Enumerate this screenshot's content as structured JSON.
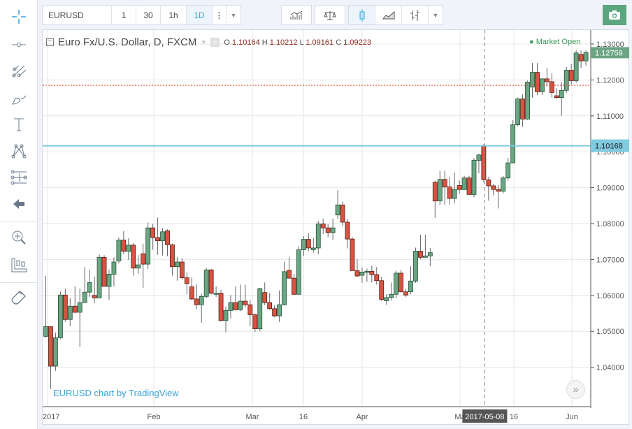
{
  "toolbar": {
    "symbol": "EURUSD",
    "intervals": [
      "1",
      "30",
      "1h",
      "1D"
    ],
    "active_interval": "1D",
    "more_icon": "vertical-dots-icon",
    "dropdown_icon": "chevron-down-icon",
    "indicators_icon": "indicators-icon",
    "compare_icon": "scales-icon",
    "chart_styles": [
      "candles-icon",
      "area-icon",
      "bars-icon"
    ],
    "active_style": "candles-icon",
    "camera_icon": "camera-icon"
  },
  "left_tools": [
    "crosshair-icon",
    "horizontal-line-icon",
    "pitchfork-icon",
    "brush-icon",
    "text-icon",
    "pattern-icon",
    "fib-icon",
    "back-arrow-icon",
    "zoom-in-icon",
    "measure-icon",
    "magnet-icon"
  ],
  "legend": {
    "title": "Euro Fx/U.S. Dollar, D, FXCM",
    "o_label": "O",
    "o": "1.10164",
    "h_label": "H",
    "h": "1.10212",
    "l_label": "L",
    "l": "1.09161",
    "c_label": "C",
    "c": "1.09223"
  },
  "market_status": "Market Open",
  "watermark": "EURUSD chart by TradingView",
  "colors": {
    "up": "#6ba583",
    "down": "#d75442",
    "up_border": "#225437",
    "down_border": "#5b1a13",
    "last_price": "#6ba583",
    "crosshair_line": "#7fcbe0",
    "alert_line": "#e5432f",
    "status": "#3a9a5b"
  },
  "chart_data": {
    "type": "candlestick",
    "title": "Euro Fx/U.S. Dollar, D, FXCM",
    "ylim": [
      1.03,
      1.135
    ],
    "y_ticks": [
      "1.13000",
      "1.12000",
      "1.11000",
      "1.10000",
      "1.09000",
      "1.08000",
      "1.07000",
      "1.06000",
      "1.05000",
      "1.04000"
    ],
    "x_ticks": [
      "2017",
      "Feb",
      "Mar",
      "16",
      "Apr",
      "Ma",
      "16",
      "Jun"
    ],
    "crosshair": {
      "date": "2017-05-08",
      "price": "1.10168"
    },
    "last_price": "1.12759",
    "horizontal_line_price": 1.1185,
    "grid": true,
    "ohlc": [
      [
        1.0486,
        1.0654,
        1.0483,
        1.0513
      ],
      [
        1.0513,
        1.0513,
        1.034,
        1.0403
      ],
      [
        1.0403,
        1.0496,
        1.039,
        1.0482
      ],
      [
        1.0482,
        1.0611,
        1.0478,
        1.0601
      ],
      [
        1.0601,
        1.0619,
        1.0526,
        1.0533
      ],
      [
        1.0533,
        1.0593,
        1.0514,
        1.057
      ],
      [
        1.057,
        1.0625,
        1.055,
        1.0553
      ],
      [
        1.0553,
        1.0619,
        1.0456,
        1.058
      ],
      [
        1.058,
        1.0679,
        1.0586,
        1.0609
      ],
      [
        1.0609,
        1.0672,
        1.0596,
        1.0636
      ],
      [
        1.06,
        1.0652,
        1.0579,
        1.0593
      ],
      [
        1.0593,
        1.0714,
        1.0593,
        1.0706
      ],
      [
        1.0706,
        1.0712,
        1.0625,
        1.0625
      ],
      [
        1.0625,
        1.0672,
        1.0587,
        1.0659
      ],
      [
        1.0659,
        1.0706,
        1.0625,
        1.0693
      ],
      [
        1.0696,
        1.0761,
        1.0689,
        1.0754
      ],
      [
        1.0754,
        1.0779,
        1.0715,
        1.0723
      ],
      [
        1.0723,
        1.0759,
        1.0699,
        1.074
      ],
      [
        1.074,
        1.0746,
        1.0655,
        1.0676
      ],
      [
        1.0676,
        1.0712,
        1.066,
        1.0685
      ],
      [
        1.0716,
        1.0744,
        1.0621,
        1.0687
      ],
      [
        1.0687,
        1.0803,
        1.0674,
        1.0788
      ],
      [
        1.0788,
        1.0799,
        1.0727,
        1.0761
      ],
      [
        1.0761,
        1.0817,
        1.0713,
        1.0752
      ],
      [
        1.0752,
        1.0787,
        1.0711,
        1.0777
      ],
      [
        1.078,
        1.0784,
        1.0709,
        1.0741
      ],
      [
        1.0741,
        1.0744,
        1.0655,
        1.068
      ],
      [
        1.068,
        1.0707,
        1.0641,
        1.0693
      ],
      [
        1.0693,
        1.0704,
        1.0644,
        1.0649
      ],
      [
        1.0649,
        1.0664,
        1.0603,
        1.0633
      ],
      [
        1.0624,
        1.065,
        1.0588,
        1.059
      ],
      [
        1.059,
        1.0631,
        1.0562,
        1.0574
      ],
      [
        1.0574,
        1.0605,
        1.0524,
        1.0597
      ],
      [
        1.0597,
        1.0677,
        1.0592,
        1.0671
      ],
      [
        1.0671,
        1.0674,
        1.0603,
        1.0606
      ],
      [
        1.0603,
        1.0625,
        1.0596,
        1.0606
      ],
      [
        1.0606,
        1.0615,
        1.0528,
        1.053
      ],
      [
        1.053,
        1.0569,
        1.0497,
        1.0558
      ],
      [
        1.0558,
        1.0601,
        1.0536,
        1.058
      ],
      [
        1.058,
        1.0625,
        1.0558,
        1.056
      ],
      [
        1.056,
        1.063,
        1.0556,
        1.0584
      ],
      [
        1.0584,
        1.063,
        1.0567,
        1.0574
      ],
      [
        1.0574,
        1.0587,
        1.0514,
        1.0546
      ],
      [
        1.0546,
        1.055,
        1.0498,
        1.0507
      ],
      [
        1.0507,
        1.0621,
        1.05,
        1.0619
      ],
      [
        1.0608,
        1.0636,
        1.0573,
        1.058
      ],
      [
        1.058,
        1.0607,
        1.056,
        1.0563
      ],
      [
        1.0563,
        1.0572,
        1.0539,
        1.0543
      ],
      [
        1.0543,
        1.0614,
        1.0526,
        1.0574
      ],
      [
        1.0574,
        1.0694,
        1.0572,
        1.0666
      ],
      [
        1.067,
        1.0707,
        1.0646,
        1.0648
      ],
      [
        1.0648,
        1.066,
        1.0601,
        1.0603
      ],
      [
        1.0603,
        1.0737,
        1.0603,
        1.0727
      ],
      [
        1.0727,
        1.0765,
        1.071,
        1.0756
      ],
      [
        1.0756,
        1.0773,
        1.0724,
        1.0732
      ],
      [
        1.0727,
        1.0759,
        1.0719,
        1.0732
      ],
      [
        1.0732,
        1.0808,
        1.0715,
        1.0799
      ],
      [
        1.0799,
        1.0814,
        1.0771,
        1.0788
      ],
      [
        1.0788,
        1.0799,
        1.0762,
        1.0775
      ],
      [
        1.0775,
        1.0814,
        1.0754,
        1.0788
      ],
      [
        1.0824,
        1.0893,
        1.0813,
        1.0852
      ],
      [
        1.0852,
        1.0862,
        1.0793,
        1.0804
      ],
      [
        1.0804,
        1.0813,
        1.0731,
        1.0757
      ],
      [
        1.0757,
        1.0762,
        1.0669,
        1.0669
      ],
      [
        1.0669,
        1.0701,
        1.0651,
        1.0654
      ],
      [
        1.0656,
        1.0678,
        1.0635,
        1.0665
      ],
      [
        1.0665,
        1.0674,
        1.0638,
        1.0667
      ],
      [
        1.0667,
        1.0683,
        1.0636,
        1.0658
      ],
      [
        1.0658,
        1.0679,
        1.063,
        1.0641
      ],
      [
        1.0641,
        1.0651,
        1.0584,
        1.0589
      ],
      [
        1.0585,
        1.0603,
        1.0574,
        1.0594
      ],
      [
        1.0594,
        1.0636,
        1.0586,
        1.0603
      ],
      [
        1.0603,
        1.0669,
        1.0592,
        1.0662
      ],
      [
        1.0662,
        1.0671,
        1.0608,
        1.061
      ],
      [
        1.061,
        1.0619,
        1.0596,
        1.0601
      ],
      [
        1.061,
        1.0681,
        1.0603,
        1.064
      ],
      [
        1.064,
        1.0733,
        1.0635,
        1.0723
      ],
      [
        1.0723,
        1.0769,
        1.0701,
        1.0706
      ],
      [
        1.0706,
        1.0769,
        1.0706,
        1.071
      ],
      [
        1.071,
        1.0732,
        1.0681,
        1.0719
      ],
      [
        1.0915,
        1.0919,
        1.0816,
        1.0863
      ],
      [
        1.0863,
        1.0947,
        1.0852,
        1.0923
      ],
      [
        1.0923,
        1.0947,
        1.0852,
        1.0902
      ],
      [
        1.0902,
        1.0929,
        1.0852,
        1.087
      ],
      [
        1.087,
        1.0942,
        1.0856,
        1.0895
      ],
      [
        1.0906,
        1.092,
        1.0883,
        1.0895
      ],
      [
        1.0895,
        1.0933,
        1.0893,
        1.0927
      ],
      [
        1.0927,
        1.0933,
        1.0881,
        1.0881
      ],
      [
        1.0881,
        1.0983,
        1.0873,
        1.0976
      ],
      [
        1.0976,
        1.0995,
        1.094,
        1.0991
      ],
      [
        1.10164,
        1.10212,
        1.09161,
        1.09223
      ],
      [
        1.0922,
        1.093,
        1.0864,
        1.0905
      ],
      [
        1.0905,
        1.0911,
        1.0879,
        1.0895
      ],
      [
        1.0895,
        1.0907,
        1.0842,
        1.089
      ],
      [
        1.089,
        1.0933,
        1.0884,
        1.0927
      ],
      [
        1.0927,
        1.0983,
        1.092,
        1.0969
      ],
      [
        1.0969,
        1.1088,
        1.0969,
        1.1075
      ],
      [
        1.1075,
        1.1151,
        1.1071,
        1.1147
      ],
      [
        1.1147,
        1.116,
        1.1069,
        1.1091
      ],
      [
        1.1091,
        1.1198,
        1.1089,
        1.1194
      ],
      [
        1.118,
        1.1247,
        1.1151,
        1.1221
      ],
      [
        1.1221,
        1.1247,
        1.1158,
        1.1167
      ],
      [
        1.1167,
        1.1205,
        1.1158,
        1.1203
      ],
      [
        1.1203,
        1.1234,
        1.1182,
        1.1195
      ],
      [
        1.1195,
        1.1219,
        1.1151,
        1.1165
      ],
      [
        1.1156,
        1.1177,
        1.1147,
        1.1151
      ],
      [
        1.1151,
        1.1194,
        1.11,
        1.1171
      ],
      [
        1.1171,
        1.1236,
        1.1164,
        1.1227
      ],
      [
        1.1227,
        1.1245,
        1.1188,
        1.1198
      ],
      [
        1.1198,
        1.1282,
        1.1192,
        1.1275
      ],
      [
        1.1271,
        1.1282,
        1.1234,
        1.1253
      ],
      [
        1.1253,
        1.1282,
        1.124,
        1.12759
      ]
    ]
  }
}
